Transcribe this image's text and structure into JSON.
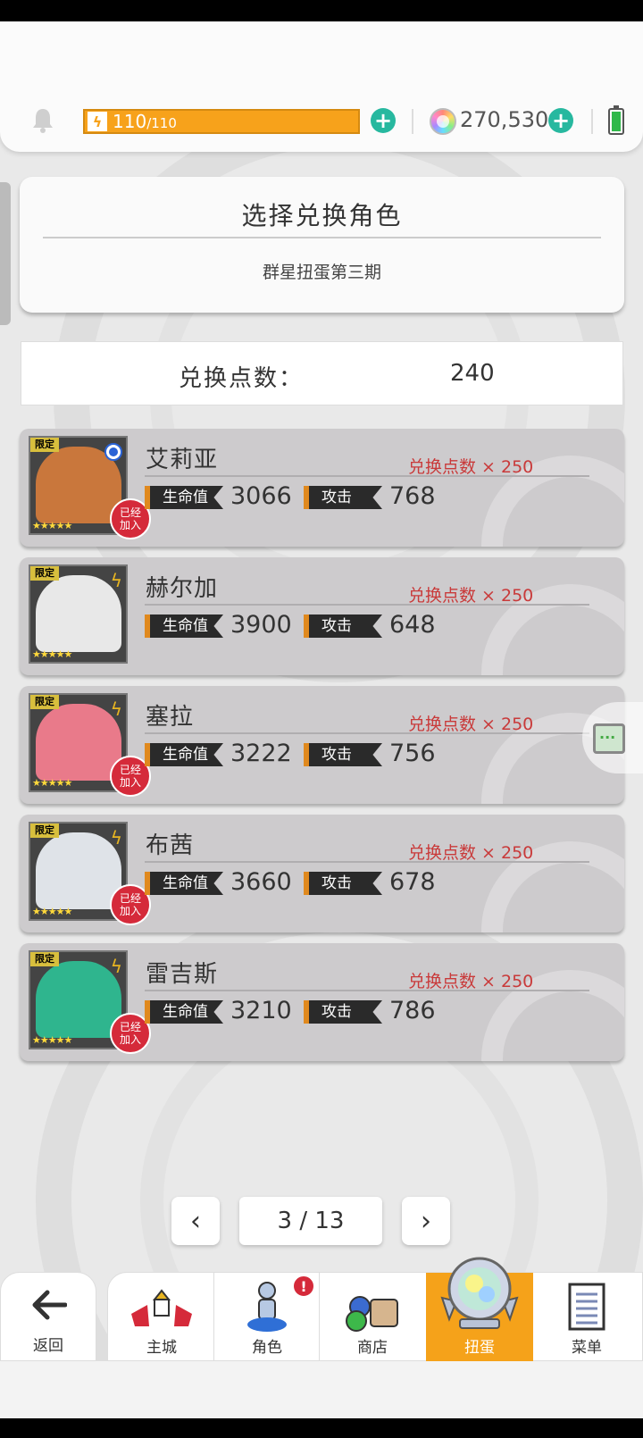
{
  "header": {
    "energy_current": "110",
    "energy_max": "/110",
    "gems": "270,530"
  },
  "panel": {
    "title": "选择兑换角色",
    "subtitle": "群星扭蛋第三期"
  },
  "points": {
    "label": "兑换点数：",
    "value": "240"
  },
  "characters": [
    {
      "name": "艾莉亚",
      "cost": "兑换点数 × 250",
      "hp_label": "生命值",
      "hp": "3066",
      "atk_label": "攻击",
      "atk": "768",
      "tag": "限定",
      "stars": "★★★★★",
      "joined": true,
      "element": "water",
      "art_color": "#c9773c"
    },
    {
      "name": "赫尔加",
      "cost": "兑换点数 × 250",
      "hp_label": "生命值",
      "hp": "3900",
      "atk_label": "攻击",
      "atk": "648",
      "tag": "限定",
      "stars": "★★★★★",
      "joined": false,
      "element": "lightning",
      "art_color": "#e8e8e8"
    },
    {
      "name": "塞拉",
      "cost": "兑换点数 × 250",
      "hp_label": "生命值",
      "hp": "3222",
      "atk_label": "攻击",
      "atk": "756",
      "tag": "限定",
      "stars": "★★★★★",
      "joined": true,
      "element": "lightning",
      "art_color": "#e97a8a"
    },
    {
      "name": "布茜",
      "cost": "兑换点数 × 250",
      "hp_label": "生命值",
      "hp": "3660",
      "atk_label": "攻击",
      "atk": "678",
      "tag": "限定",
      "stars": "★★★★★",
      "joined": true,
      "element": "lightning",
      "art_color": "#dfe3e8"
    },
    {
      "name": "雷吉斯",
      "cost": "兑换点数 × 250",
      "hp_label": "生命值",
      "hp": "3210",
      "atk_label": "攻击",
      "atk": "786",
      "tag": "限定",
      "stars": "★★★★★",
      "joined": true,
      "element": "lightning",
      "art_color": "#2fb58e"
    }
  ],
  "joined_label_1": "已经",
  "joined_label_2": "加入",
  "pager": {
    "text": "3 / 13",
    "prev": "‹",
    "next": "›"
  },
  "nav": {
    "back": "返回",
    "items": [
      "主城",
      "角色",
      "商店",
      "扭蛋",
      "菜单"
    ],
    "active": "扭蛋",
    "badge": "!"
  },
  "colors": {
    "energy": "#f7a21b",
    "accent_orange": "#f5a21a",
    "cost_red": "#c93a3a",
    "plus_teal": "#27b89f"
  },
  "icons": [
    "bell-icon",
    "bolt-icon",
    "plus-icon",
    "gem-icon",
    "battery-icon",
    "back-arrow-icon",
    "castle-icon",
    "character-icon",
    "shop-icon",
    "gacha-icon",
    "menu-icon",
    "chat-icon"
  ]
}
